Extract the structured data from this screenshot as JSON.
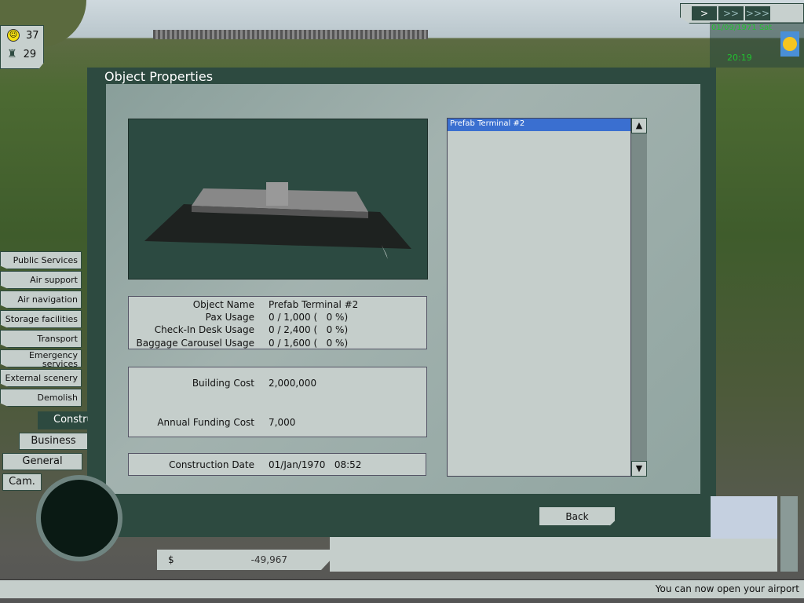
{
  "hud": {
    "happiness": "37",
    "staff": "29",
    "date": "01/09/1971 Sat",
    "time": "20:19",
    "speed_buttons": [
      ">",
      ">>",
      ">>>"
    ],
    "money_symbol": "$",
    "money": "-49,967"
  },
  "dialog": {
    "title": "Object Properties",
    "back": "Back",
    "list": {
      "items": [
        "Prefab Terminal #2"
      ],
      "scroll_up": "▲",
      "scroll_down": "▼"
    },
    "info": [
      {
        "label": "Object Name",
        "value": "Prefab Terminal #2"
      },
      {
        "label": "Pax Usage",
        "value": "0 / 1,000 (   0 %)"
      },
      {
        "label": "Check-In Desk Usage",
        "value": "0 / 2,400 (   0 %)"
      },
      {
        "label": "Baggage Carousel Usage",
        "value": "0 / 1,600 (   0 %)"
      }
    ],
    "costs": [
      {
        "label": "Building Cost",
        "value": "2,000,000"
      },
      {
        "label": "Annual Funding Cost",
        "value": "7,000"
      }
    ],
    "construction": {
      "label": "Construction Date",
      "value": "01/Jan/1970   08:52"
    }
  },
  "sidebar": {
    "items": [
      "Public Services",
      "Air support",
      "Air navigation",
      "Storage facilities",
      "Transport",
      "Emergency services",
      "External scenery",
      "Demolish"
    ],
    "tabs": {
      "construction": "Construction",
      "business": "Business",
      "general": "General",
      "cam": "Cam."
    }
  },
  "status": "You can now open your airport",
  "colors": {
    "panel": "#2d4a40",
    "selection": "#3a6fd0",
    "clock_text": "#22c030"
  }
}
